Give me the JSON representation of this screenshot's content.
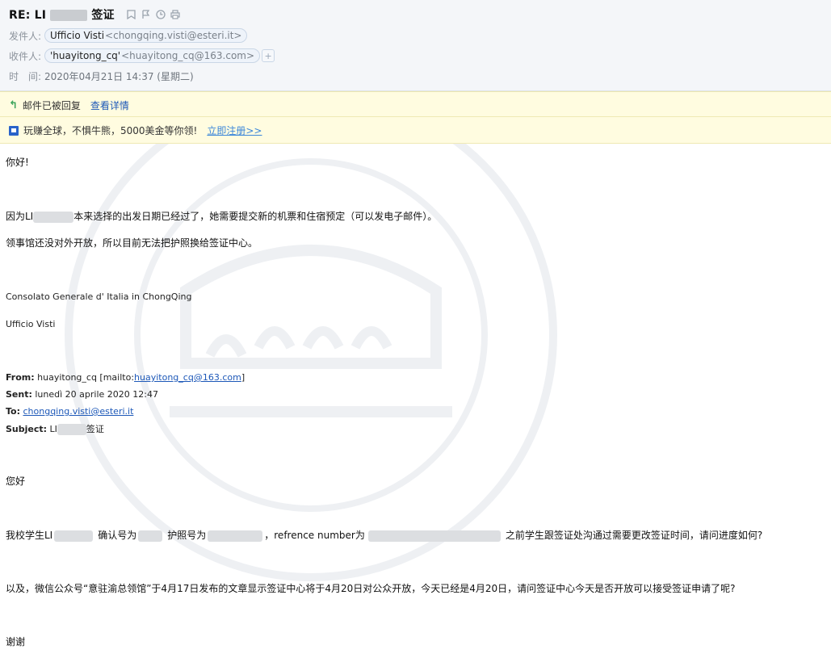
{
  "email": {
    "subject_prefix": "RE: LI",
    "subject_suffix": "签证",
    "from_label": "发件人:",
    "from_name": "Ufficio Visti",
    "from_addr": "<chongqing.visti@esteri.it>",
    "to_label": "收件人:",
    "to_name": "'huayitong_cq'",
    "to_addr": "<huayitong_cq@163.com>",
    "time_label": "时　间:",
    "time_value": "2020年04月21日 14:37 (星期二)"
  },
  "notices": {
    "replied_text": "邮件已被回复",
    "replied_link": "查看详情",
    "ad_text": "玩赚全球，不惧牛熊，5000美金等你领!",
    "ad_link": "立即注册>>"
  },
  "body": {
    "greeting": "你好!",
    "para1_prefix": "因为LI",
    "para1_suffix": "本来选择的出发日期已经过了，她需要提交新的机票和住宿预定（可以发电子邮件）。",
    "para2": "领事馆还没对外开放，所以目前无法把护照换给签证中心。",
    "sig1": "Consolato Generale d' Italia in ChongQing",
    "sig2": "Ufficio Visti",
    "from_label": "From:",
    "from_value": "huayitong_cq [mailto:",
    "from_link": "huayitong_cq@163.com",
    "from_close": "]",
    "sent_label": "Sent:",
    "sent_value": "lunedì 20 aprile 2020 12:47",
    "to_label": "To:",
    "to_link": "chongqing.visti@esteri.it",
    "subject_label": "Subject:",
    "subject_prefix": "LI",
    "subject_suffix": "签证",
    "greeting2": "您好",
    "q1_a": "我校学生LI",
    "q1_b": "确认号为",
    "q1_c": "护照号为",
    "q1_d": "，refrence number为",
    "q1_e": "之前学生跟签证处沟通过需要更改签证时间，请问进度如何?",
    "q2": "以及，微信公众号“意驻渝总领馆”于4月17日发布的文章显示签证中心将于4月20日对公众开放，今天已经是4月20日，请问签证中心今天是否开放可以接受签证申请了呢?",
    "thanks": "谢谢"
  },
  "icons": {
    "flag": "flag-icon",
    "bookmark": "bookmark-icon",
    "clock": "clock-icon",
    "print": "print-icon",
    "reply": "reply-arrow-icon",
    "ad": "ad-badge-icon"
  },
  "colors": {
    "header_bg": "#f4f6f9",
    "notice_bg": "#fffce0",
    "link": "#1d58b8"
  }
}
